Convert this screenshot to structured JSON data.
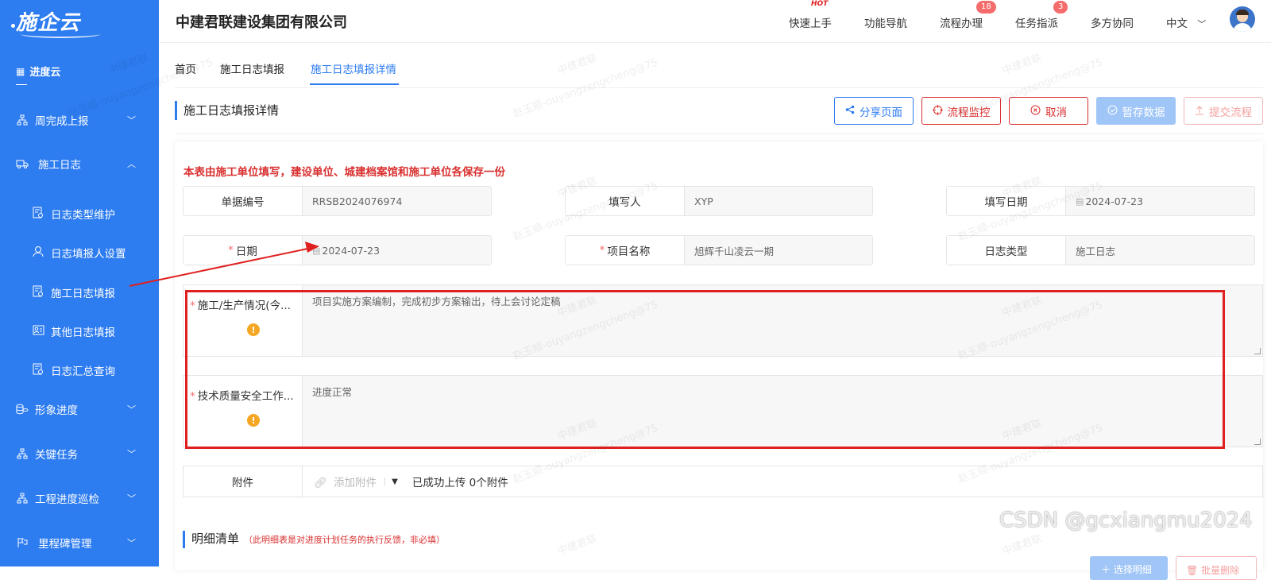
{
  "sidebar": {
    "logo": "施企云",
    "section": "进度云",
    "menus": [
      {
        "label": "周完成上报",
        "icon": "org-icon"
      },
      {
        "label": "施工日志",
        "icon": "truck-icon"
      },
      {
        "label": "形象进度",
        "icon": "coins-icon"
      },
      {
        "label": "关键任务",
        "icon": "org-icon"
      },
      {
        "label": "工程进度巡检",
        "icon": "org-icon"
      },
      {
        "label": "里程碑管理",
        "icon": "milestone-icon"
      }
    ],
    "submenus": [
      {
        "label": "日志类型维护",
        "icon": "doc-gear-icon"
      },
      {
        "label": "日志填报人设置",
        "icon": "user-icon"
      },
      {
        "label": "施工日志填报",
        "icon": "doc-edit-icon"
      },
      {
        "label": "其他日志填报",
        "icon": "id-card-icon"
      },
      {
        "label": "日志汇总查询",
        "icon": "doc-search-icon"
      }
    ]
  },
  "header": {
    "company": "中建君联建设集团有限公司",
    "nav": [
      {
        "label": "快速上手",
        "badge": "HOT"
      },
      {
        "label": "功能导航",
        "badge": ""
      },
      {
        "label": "流程办理",
        "badge": "18"
      },
      {
        "label": "任务指派",
        "badge": "3"
      },
      {
        "label": "多方协同",
        "badge": ""
      }
    ],
    "language": "中文"
  },
  "tabs": [
    "首页",
    "施工日志填报",
    "施工日志填报详情"
  ],
  "page": {
    "title": "施工日志填报详情",
    "buttons": {
      "share": "分享页面",
      "monitor": "流程监控",
      "cancel": "取消",
      "save": "暂存数据",
      "submit": "提交流程"
    },
    "notice": "本表由施工单位填写，建设单位、城建档案馆和施工单位各保存一份"
  },
  "form": {
    "doc_no": {
      "label": "单据编号",
      "value": "RRSB2024076974"
    },
    "writer": {
      "label": "填写人",
      "value": "XYP"
    },
    "write_date": {
      "label": "填写日期",
      "value": "2024-07-23"
    },
    "date": {
      "label": "日期",
      "value": "2024-07-23"
    },
    "project": {
      "label": "项目名称",
      "value": "旭辉千山凌云一期"
    },
    "log_type": {
      "label": "日志类型",
      "value": "施工日志"
    },
    "production": {
      "label": "施工/生产情况(今...",
      "value": "项目实施方案编制，完成初步方案输出，待上会讨论定稿"
    },
    "quality": {
      "label": "技术质量安全工作...",
      "value": "进度正常"
    },
    "attachment": {
      "label": "附件",
      "add": "添加附件",
      "status": "已成功上传 0个附件"
    }
  },
  "detail": {
    "title": "明细清单",
    "note": "（此明细表是对进度计划任务的执行反馈，非必填）",
    "select_button": "选择明细",
    "delete_button": "批量删除"
  },
  "watermark": {
    "name": "中建君联",
    "user": "赵玉顺-ouyangzengcheng@75"
  },
  "csdn": "CSDN @gcxiangmu2024"
}
